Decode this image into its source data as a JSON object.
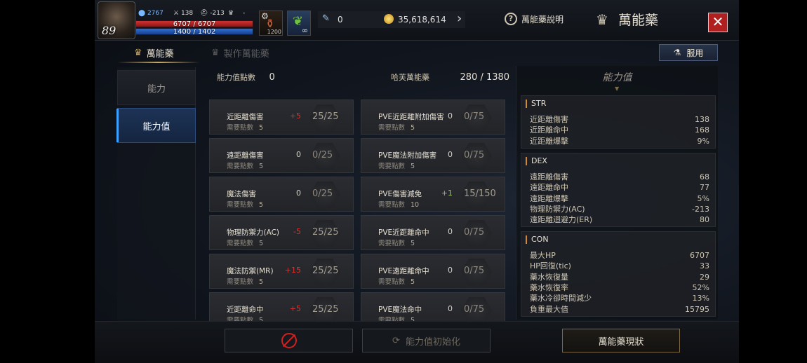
{
  "header": {
    "level": "89",
    "power": "2767",
    "attack": "138",
    "defense": "-213",
    "rank": "-",
    "hp": "6707 / 6707",
    "mp": "1400 / 1402",
    "slot_label": "1200",
    "slot_infinity": "∞",
    "tickets": "0",
    "gold": "35,618,614",
    "help_label": "萬能藥說明",
    "title": "萬能藥"
  },
  "tabs": [
    {
      "label": "萬能藥",
      "active": true
    },
    {
      "label": "製作萬能藥",
      "active": false
    }
  ],
  "use_button": "服用",
  "side_menu": [
    {
      "label": "能力",
      "active": false
    },
    {
      "label": "能力值",
      "active": true
    }
  ],
  "points": {
    "ability_label": "能力值點數",
    "ability_value": "0",
    "potion_label": "哈芙萬能藥",
    "potion_value": "280 / 1380"
  },
  "req_label": "需要點數",
  "stats_left": [
    {
      "name": "近距離傷害",
      "bonus": "+5",
      "bonus_type": "red",
      "level": "25/25",
      "req": "5"
    },
    {
      "name": "遠距離傷害",
      "bonus": "0",
      "bonus_type": "zero",
      "level": "0/25",
      "req": "5"
    },
    {
      "name": "魔法傷害",
      "bonus": "0",
      "bonus_type": "zero",
      "level": "0/25",
      "req": "5"
    },
    {
      "name": "物理防禦力(AC)",
      "bonus": "-5",
      "bonus_type": "red",
      "level": "25/25",
      "req": "5"
    },
    {
      "name": "魔法防禦(MR)",
      "bonus": "+15",
      "bonus_type": "red",
      "level": "25/25",
      "req": "5"
    },
    {
      "name": "近距離命中",
      "bonus": "+5",
      "bonus_type": "red",
      "level": "25/25",
      "req": "5"
    }
  ],
  "stats_right": [
    {
      "name": "PVE近距離附加傷害",
      "bonus": "0",
      "bonus_type": "zero",
      "level": "0/75",
      "req": "5"
    },
    {
      "name": "PVE魔法附加傷害",
      "bonus": "0",
      "bonus_type": "zero",
      "level": "0/75",
      "req": "5"
    },
    {
      "name": "PVE傷害減免",
      "bonus": "+1",
      "bonus_type": "green",
      "level": "15/150",
      "req": "10"
    },
    {
      "name": "PVE近距離命中",
      "bonus": "0",
      "bonus_type": "zero",
      "level": "0/75",
      "req": "5"
    },
    {
      "name": "PVE遠距離命中",
      "bonus": "0",
      "bonus_type": "zero",
      "level": "0/75",
      "req": "5"
    },
    {
      "name": "PVE魔法命中",
      "bonus": "0",
      "bonus_type": "zero",
      "level": "0/75",
      "req": "5"
    }
  ],
  "info": {
    "title": "能力值",
    "str": {
      "head": "STR",
      "rows": [
        {
          "k": "近距離傷害",
          "v": "138"
        },
        {
          "k": "近距離命中",
          "v": "168"
        },
        {
          "k": "近距離爆擊",
          "v": "9%"
        }
      ]
    },
    "dex": {
      "head": "DEX",
      "rows": [
        {
          "k": "遠距離傷害",
          "v": "68"
        },
        {
          "k": "遠距離命中",
          "v": "77"
        },
        {
          "k": "遠距離爆擊",
          "v": "5%"
        },
        {
          "k": "物理防禦力(AC)",
          "v": "-213"
        },
        {
          "k": "遠距離迴避力(ER)",
          "v": "80"
        }
      ]
    },
    "con": {
      "head": "CON",
      "rows": [
        {
          "k": "最大HP",
          "v": "6707"
        },
        {
          "k": "HP回復(tic)",
          "v": "33"
        },
        {
          "k": "藥水恢復量",
          "v": "29"
        },
        {
          "k": "藥水恢復率",
          "v": "52%"
        },
        {
          "k": "藥水冷卻時間減少",
          "v": "13%"
        },
        {
          "k": "負重最大值",
          "v": "15795"
        }
      ]
    }
  },
  "bottom": {
    "reset_label": "能力值初始化",
    "status_label": "萬能藥現狀"
  },
  "colors": {
    "accent_gold": "#c8a86a",
    "hp_red": "#d13232",
    "mp_blue": "#2f6fd0",
    "bonus_red": "#e0302a",
    "bonus_green": "#9bc84c"
  }
}
